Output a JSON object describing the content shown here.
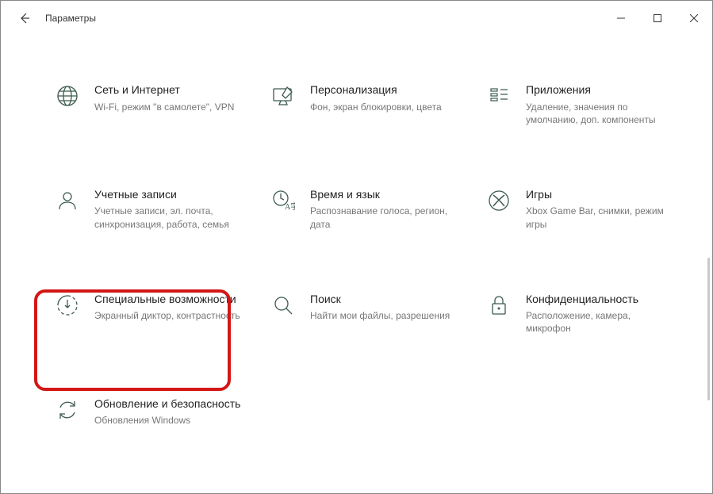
{
  "window": {
    "title": "Параметры"
  },
  "tiles": {
    "network": {
      "title": "Сеть и Интернет",
      "sub": "Wi-Fi, режим \"в самолете\", VPN"
    },
    "personalization": {
      "title": "Персонализация",
      "sub": "Фон, экран блокировки, цвета"
    },
    "apps": {
      "title": "Приложения",
      "sub": "Удаление, значения по умолчанию, доп. компоненты"
    },
    "accounts": {
      "title": "Учетные записи",
      "sub": "Учетные записи, эл. почта, синхронизация, работа, семья"
    },
    "time": {
      "title": "Время и язык",
      "sub": "Распознавание голоса, регион, дата"
    },
    "gaming": {
      "title": "Игры",
      "sub": "Xbox Game Bar, снимки, режим игры"
    },
    "accessibility": {
      "title": "Специальные возможности",
      "sub": "Экранный диктор, контрастность"
    },
    "search": {
      "title": "Поиск",
      "sub": "Найти мои файлы, разрешения"
    },
    "privacy": {
      "title": "Конфиденциальность",
      "sub": "Расположение, камера, микрофон"
    },
    "update": {
      "title": "Обновление и безопасность",
      "sub": "Обновления Windows"
    }
  }
}
